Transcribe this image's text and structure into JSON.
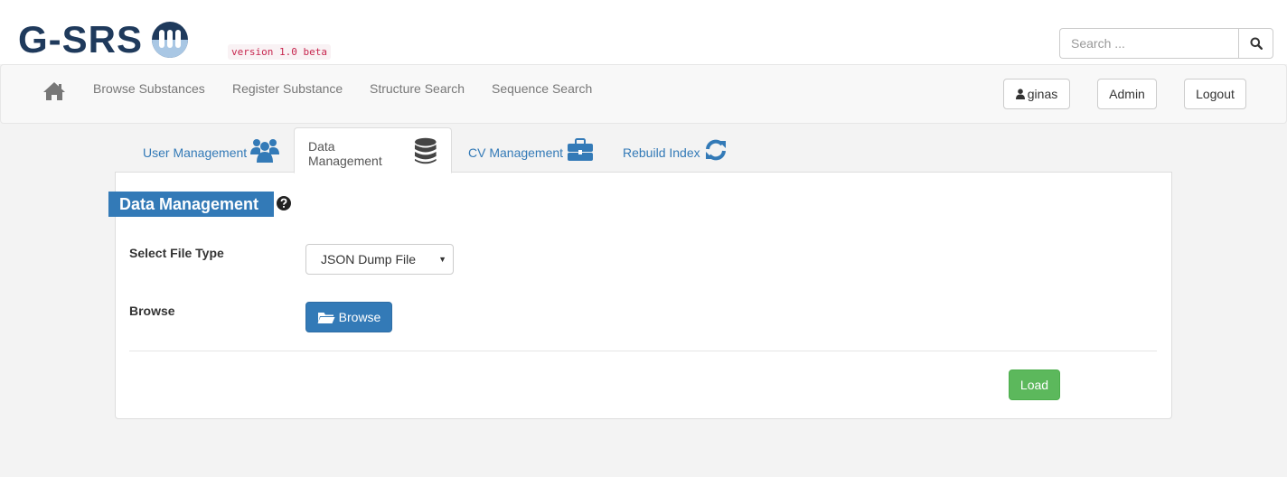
{
  "header": {
    "logo_text": "G-SRS",
    "version": "version 1.0 beta",
    "search_placeholder": "Search ..."
  },
  "navbar": {
    "links": [
      "Browse Substances",
      "Register Substance",
      "Structure Search",
      "Sequence Search"
    ],
    "user_label": "ginas",
    "admin_label": "Admin",
    "logout_label": "Logout"
  },
  "tabs": [
    {
      "label": "User Management",
      "icon": "users-icon",
      "active": false
    },
    {
      "label": "Data Management",
      "icon": "database-icon",
      "active": true
    },
    {
      "label": "CV Management",
      "icon": "briefcase-icon",
      "active": false
    },
    {
      "label": "Rebuild Index",
      "icon": "refresh-icon",
      "active": false
    }
  ],
  "panel": {
    "title": "Data Management",
    "file_type_label": "Select File Type",
    "file_type_value": "JSON Dump File",
    "browse_label": "Browse",
    "browse_button": "Browse",
    "load_button": "Load"
  },
  "colors": {
    "primary": "#337ab7",
    "success": "#5cb85c",
    "logo": "#1f3a5c"
  }
}
